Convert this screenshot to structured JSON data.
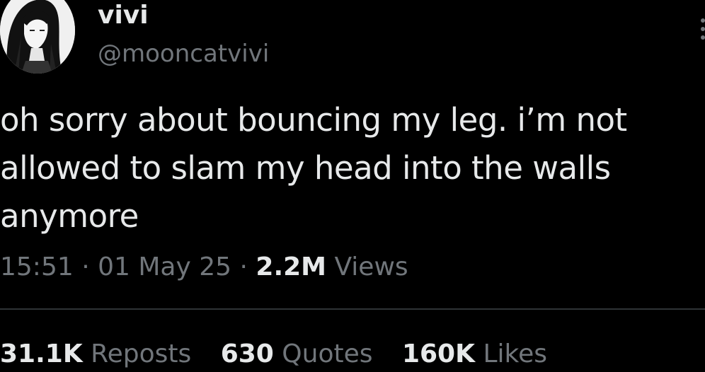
{
  "author": {
    "display_name": "vivi",
    "handle": "@mooncatvivi",
    "avatar_icon": "avatar-illustration"
  },
  "tweet": {
    "lines": [
      "oh sorry about bouncing my leg. i’m not",
      "allowed to slam my head into the walls",
      "anymore"
    ]
  },
  "meta": {
    "time": "15:51",
    "separator": "·",
    "date": "01 May 25",
    "views_count": "2.2M",
    "views_label": "Views"
  },
  "stats": {
    "reposts_count": "31.1K",
    "reposts_label": "Reposts",
    "quotes_count": "630",
    "quotes_label": "Quotes",
    "likes_count": "160K",
    "likes_label": "Likes"
  },
  "colors": {
    "background": "#000000",
    "primary_text": "#e7e9ea",
    "secondary_text": "#71767b",
    "divider": "#2f3336"
  }
}
